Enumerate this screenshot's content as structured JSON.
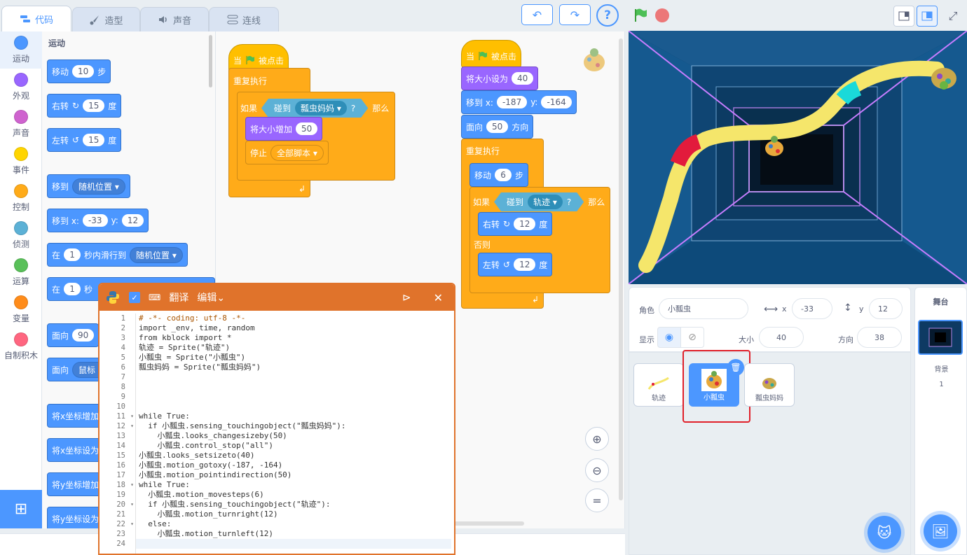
{
  "tabs": [
    {
      "label": "代码",
      "icon": "code-icon"
    },
    {
      "label": "造型",
      "icon": "brush-icon"
    },
    {
      "label": "声音",
      "icon": "speaker-icon"
    },
    {
      "label": "连线",
      "icon": "connect-icon"
    }
  ],
  "categories": [
    {
      "label": "运动",
      "color": "#4c97ff"
    },
    {
      "label": "外观",
      "color": "#9966ff"
    },
    {
      "label": "声音",
      "color": "#cf63cf"
    },
    {
      "label": "事件",
      "color": "#ffd500"
    },
    {
      "label": "控制",
      "color": "#ffab19"
    },
    {
      "label": "侦测",
      "color": "#5cb1d6"
    },
    {
      "label": "运算",
      "color": "#59c059"
    },
    {
      "label": "变量",
      "color": "#ff8c1a"
    },
    {
      "label": "自制积木",
      "color": "#ff6680"
    }
  ],
  "palette": {
    "section": "运动",
    "move": {
      "a": "移动",
      "v": "10",
      "b": "步"
    },
    "turn_right": {
      "a": "右转",
      "v": "15",
      "b": "度"
    },
    "turn_left": {
      "a": "左转",
      "v": "15",
      "b": "度"
    },
    "goto": {
      "a": "移到",
      "d": "随机位置"
    },
    "goto_xy": {
      "a": "移到 x:",
      "x": "-33",
      "b": "y:",
      "y": "12"
    },
    "glide": {
      "a": "在",
      "v": "1",
      "b": "秒内滑行到",
      "d": "随机位置"
    },
    "glide2": {
      "a": "在",
      "v": "1",
      "b": "秒"
    },
    "point": {
      "a": "面向",
      "v": "90"
    },
    "point_towards": {
      "a": "面向",
      "d": "鼠标"
    },
    "chx": "将x坐标增加",
    "setx": "将x坐标设为",
    "chy": "将y坐标增加",
    "sety": "将y坐标设为"
  },
  "script1": {
    "hat": "当",
    "hat2": "被点击",
    "forever": "重复执行",
    "if": "如果",
    "touch": "碰到",
    "touch_target": "瓢虫妈妈",
    "q": "?",
    "then": "那么",
    "grow": "将大小增加",
    "grow_v": "50",
    "stop": "停止",
    "stop_v": "全部脚本"
  },
  "script2": {
    "hat": "当",
    "hat2": "被点击",
    "setsize": "将大小设为",
    "setsize_v": "40",
    "goto": "移到 x:",
    "x": "-187",
    "y_label": "y:",
    "y": "-164",
    "point": "面向",
    "point_v": "50",
    "dir": "方向",
    "forever": "重复执行",
    "move": "移动",
    "move_v": "6",
    "steps": "步",
    "if": "如果",
    "touch": "碰到",
    "touch_target": "轨迹",
    "q": "?",
    "then": "那么",
    "turn_r": "右转",
    "turn_r_v": "12",
    "deg": "度",
    "else": "否则",
    "turn_l": "左转",
    "turn_l_v": "12"
  },
  "python": {
    "translate": "翻译",
    "edit": "编辑",
    "lines": [
      "# -*- coding: utf-8 -*-",
      "import _env, time, random",
      "from kblock import *",
      "轨迹 = Sprite(\"轨迹\")",
      "小瓢虫 = Sprite(\"小瓢虫\")",
      "瓢虫妈妈 = Sprite(\"瓢虫妈妈\")",
      "",
      "",
      "",
      "",
      "while True:",
      "  if 小瓢虫.sensing_touchingobject(\"瓢虫妈妈\"):",
      "    小瓢虫.looks_changesizeby(50)",
      "    小瓢虫.control_stop(\"all\")",
      "小瓢虫.looks_setsizeto(40)",
      "小瓢虫.motion_gotoxy(-187, -164)",
      "小瓢虫.motion_pointindirection(50)",
      "while True:",
      "  小瓢虫.motion_movesteps(6)",
      "  if 小瓢虫.sensing_touchingobject(\"轨迹\"):",
      "    小瓢虫.motion_turnright(12)",
      "  else:",
      "    小瓢虫.motion_turnleft(12)",
      ""
    ],
    "line_numbers": [
      "1",
      "2",
      "3",
      "4",
      "5",
      "6",
      "7",
      "8",
      "9",
      "10",
      "11",
      "12",
      "13",
      "14",
      "15",
      "16",
      "17",
      "18",
      "19",
      "20",
      "21",
      "22",
      "23",
      "24"
    ]
  },
  "sprite_info": {
    "role_label": "角色",
    "name": "小瓢虫",
    "x_label": "x",
    "x": "-33",
    "y_label": "y",
    "y": "12",
    "show_label": "显示",
    "size_label": "大小",
    "size": "40",
    "dir_label": "方向",
    "dir": "38"
  },
  "sprites": [
    {
      "name": "轨迹"
    },
    {
      "name": "小瓢虫",
      "selected": true
    },
    {
      "name": "瓢虫妈妈"
    }
  ],
  "stage_panel": {
    "title": "舞台",
    "backdrop_label": "背景",
    "backdrop_count": "1"
  }
}
